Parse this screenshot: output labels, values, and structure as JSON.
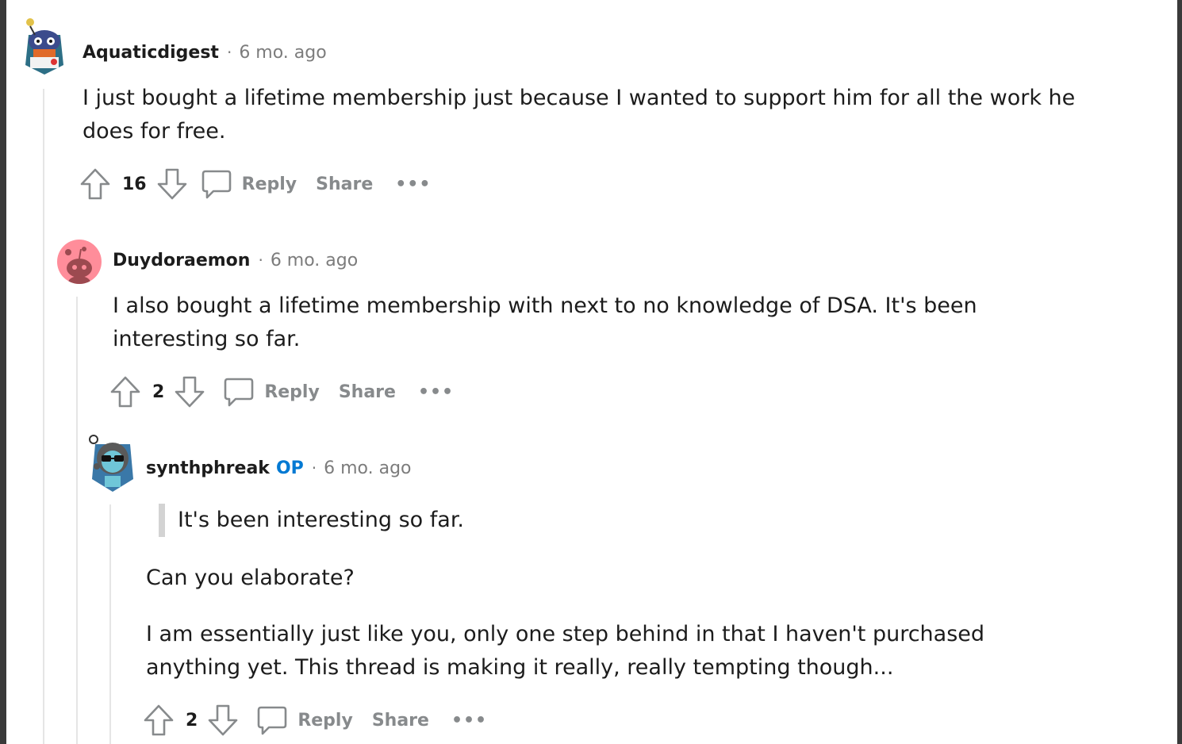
{
  "comments": [
    {
      "author": "Aquaticdigest",
      "time": "6 mo. ago",
      "body": "I just bought a lifetime membership just because I wanted to support him for all the work he does for free.",
      "score": "16",
      "reply_label": "Reply",
      "share_label": "Share",
      "more_label": "•••"
    },
    {
      "author": "Duydoraemon",
      "time": "6 mo. ago",
      "body": "I also bought a lifetime membership with next to no knowledge of DSA. It's been interesting so far.",
      "score": "2",
      "reply_label": "Reply",
      "share_label": "Share",
      "more_label": "•••"
    },
    {
      "author": "synthphreak",
      "op_badge": "OP",
      "time": "6 mo. ago",
      "quote": "It's been interesting so far.",
      "body_p1": "Can you elaborate?",
      "body_p2": "I am essentially just like you, only one step behind in that I haven't purchased anything yet. This thread is making it really, really tempting though...",
      "score": "2",
      "reply_label": "Reply",
      "share_label": "Share",
      "more_label": "•••"
    }
  ],
  "separator": "·",
  "colors": {
    "op_badge": "#0079d3",
    "meta_gray": "#7c7c7c",
    "action_gray": "#878a8c",
    "thread_line": "#e5e5e5",
    "avatar_pink": "#ff8d9a"
  }
}
